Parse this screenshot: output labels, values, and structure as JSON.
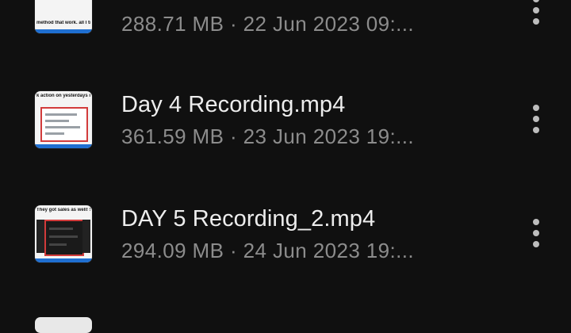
{
  "files": [
    {
      "name": "",
      "meta": "288.71 MB · 22 Jun 2023 09:...",
      "thumb_caption": "method that work. all I tried",
      "more_icon": "more-vert-icon"
    },
    {
      "name": "Day 4 Recording.mp4",
      "meta": "361.59 MB · 23 Jun 2023 19:...",
      "thumb_caption": "k action on yesterdays m\nmethod, got sale!",
      "more_icon": "more-vert-icon"
    },
    {
      "name": "DAY 5 Recording_2.mp4",
      "meta": "294.09 MB · 24 Jun 2023 19:...",
      "thumb_caption": "They got sales as well! Sh",
      "more_icon": "more-vert-icon"
    }
  ],
  "colors": {
    "background": "#101010",
    "title": "#ededed",
    "meta": "#8c8c8c",
    "accent_blue": "#1f6fd1",
    "thumb_border_red": "#d23b3b"
  }
}
